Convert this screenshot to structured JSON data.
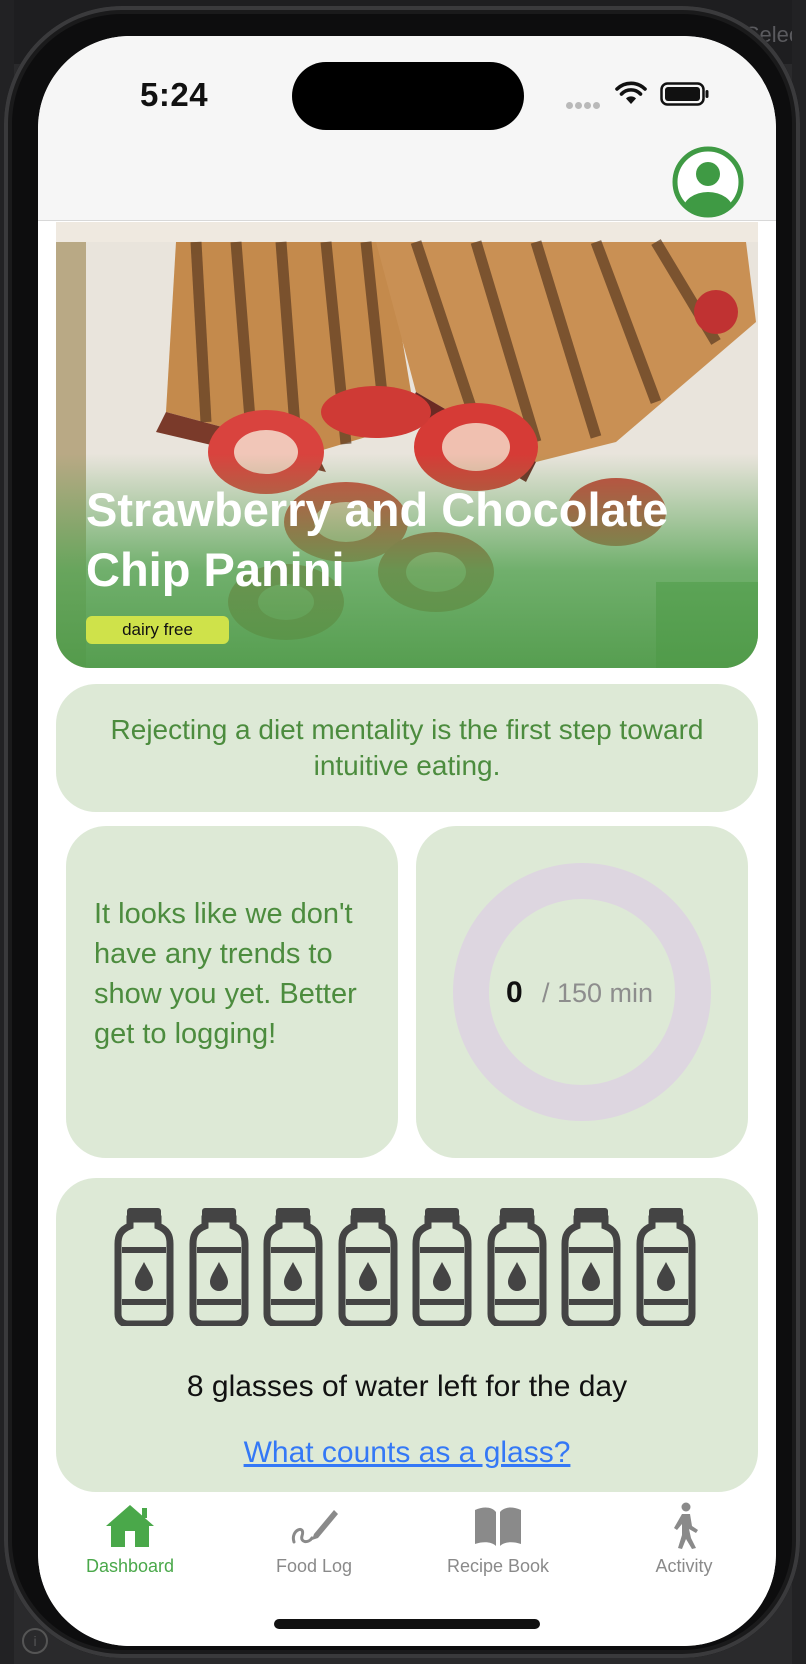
{
  "status_bar": {
    "time": "5:24"
  },
  "host": {
    "select_fragment": "Select"
  },
  "hero": {
    "title": "Strawberry and Chocolate Chip Panini",
    "tag": "dairy free"
  },
  "quote": {
    "text": "Rejecting a diet mentality is the first step toward intuitive eating."
  },
  "trends": {
    "message": "It looks like we don't have any trends to show you yet. Better get to logging!"
  },
  "activity": {
    "value": "0",
    "goal_label": "/ 150 min",
    "progress": 0
  },
  "water": {
    "glasses_total": 8,
    "glasses_filled": 0,
    "message": "8 glasses of water left for the day",
    "link_label": "What counts as a glass?"
  },
  "tabs": [
    {
      "label": "Dashboard",
      "icon": "house-icon",
      "active": true
    },
    {
      "label": "Food Log",
      "icon": "pen-icon",
      "active": false
    },
    {
      "label": "Recipe Book",
      "icon": "book-icon",
      "active": false
    },
    {
      "label": "Activity",
      "icon": "walking-icon",
      "active": false
    }
  ],
  "colors": {
    "accent_green": "#4aa84a",
    "card_bg": "#dde9d6",
    "quote_text": "#4c8c3e",
    "tag_bg": "#cfe24a",
    "link": "#3478f6",
    "ring_track": "#ddd6e0"
  }
}
